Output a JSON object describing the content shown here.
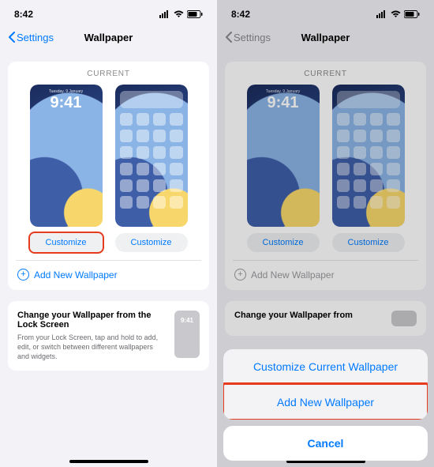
{
  "left": {
    "status": {
      "time": "8:42"
    },
    "nav": {
      "back": "Settings",
      "title": "Wallpaper"
    },
    "section_label": "CURRENT",
    "lock": {
      "date": "Tuesday, 9 January",
      "time": "9:41"
    },
    "customize": {
      "left": "Customize",
      "right": "Customize"
    },
    "add_label": "Add New Wallpaper",
    "change": {
      "title": "Change your Wallpaper from the Lock Screen",
      "body": "From your Lock Screen, tap and hold to add, edit, or switch between different wallpapers and widgets.",
      "mini_time": "9:41"
    }
  },
  "right": {
    "status": {
      "time": "8:42"
    },
    "nav": {
      "back": "Settings",
      "title": "Wallpaper"
    },
    "section_label": "CURRENT",
    "lock": {
      "date": "Tuesday, 9 January",
      "time": "9:41"
    },
    "customize": {
      "left": "Customize",
      "right": "Customize"
    },
    "add_label": "Add New Wallpaper",
    "change": {
      "title": "Change your Wallpaper from"
    },
    "sheet": {
      "option1": "Customize Current Wallpaper",
      "option2": "Add New Wallpaper",
      "cancel": "Cancel"
    }
  }
}
